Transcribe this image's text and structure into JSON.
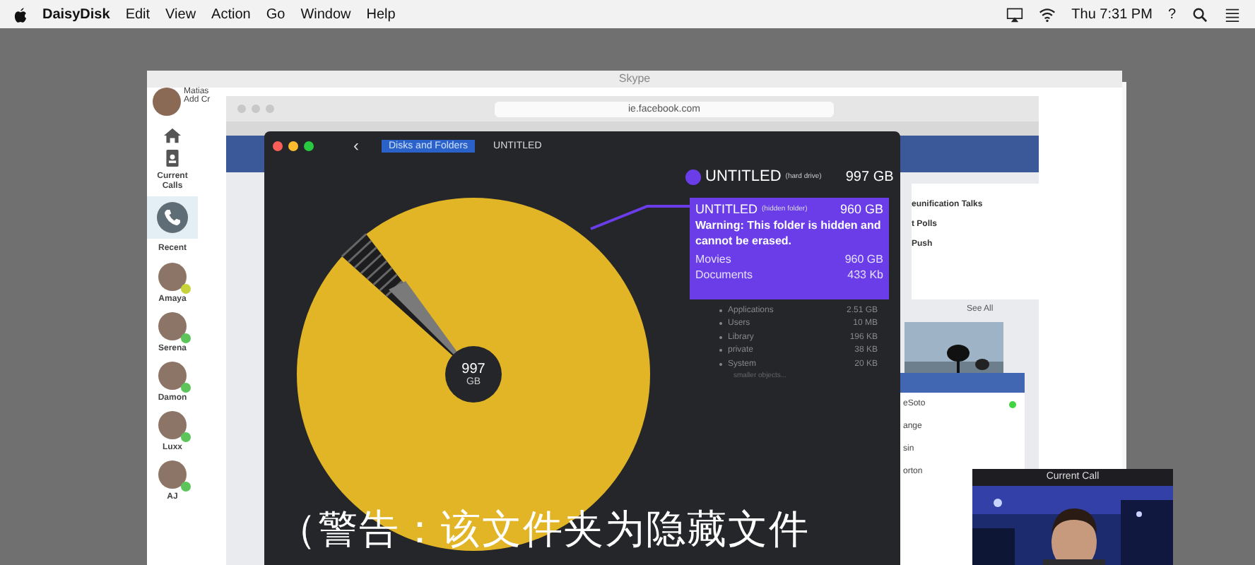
{
  "menu_bar": {
    "app": "DaisyDisk",
    "menus": [
      "Edit",
      "View",
      "Action",
      "Go",
      "Window",
      "Help"
    ],
    "clock": "Thu 7:31 PM",
    "help": "?"
  },
  "skype": {
    "title": "Skype",
    "user_name": "Matias",
    "user_sub": "Add Cr",
    "current_calls": "Current Calls",
    "recent": "Recent",
    "contacts": [
      {
        "name": "Amaya",
        "color": "#c8d23a"
      },
      {
        "name": "Serena",
        "color": "#5cc45a"
      },
      {
        "name": "Damon",
        "color": "#5cc45a"
      },
      {
        "name": "Luxx",
        "color": "#5cc45a"
      },
      {
        "name": "AJ",
        "color": "#5cc45a"
      }
    ]
  },
  "browser": {
    "address": "ie.facebook.com",
    "feed": [
      {
        "title": "eunification Talks"
      },
      {
        "title": "t Polls"
      },
      {
        "title": "Push"
      }
    ],
    "see_all": "See All",
    "chat": [
      {
        "name": "eSoto",
        "online": true
      },
      {
        "name": "ange",
        "online": false
      },
      {
        "name": "sin",
        "online": false
      },
      {
        "name": "orton",
        "online": false
      }
    ]
  },
  "daisydisk": {
    "back": "‹",
    "breadcrumb": [
      {
        "label": "Disks and Folders",
        "selected": true
      },
      {
        "label": "UNTITLED",
        "selected": false
      }
    ],
    "center": {
      "value": "997",
      "unit": "GB"
    },
    "drive": {
      "name": "UNTITLED",
      "tag": "(hard drive)",
      "size": "997 GB"
    },
    "tooltip": {
      "name": "UNTITLED",
      "tag": "(hidden folder)",
      "size": "960 GB",
      "warning": "Warning: This folder is hidden and cannot be erased.",
      "items": [
        {
          "name": "Movies",
          "size": "960 GB"
        },
        {
          "name": "Documents",
          "size": "433 Kb"
        }
      ]
    },
    "list": [
      {
        "name": "Applications",
        "size": "2.51 GB"
      },
      {
        "name": "Users",
        "size": "10 MB"
      },
      {
        "name": "Library",
        "size": "196 KB"
      },
      {
        "name": "private",
        "size": "38 KB"
      },
      {
        "name": "System",
        "size": "20 KB"
      }
    ],
    "more": "smaller objects..."
  },
  "call": {
    "title": "Current Call"
  },
  "subtitle": "（警告：该文件夹为隐藏文件"
}
